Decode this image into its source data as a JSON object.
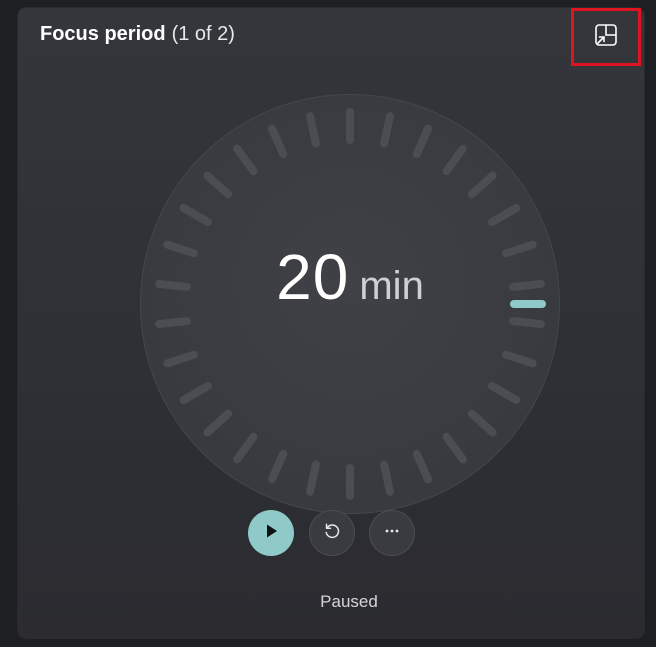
{
  "header": {
    "title": "Focus period",
    "subtitle": "(1 of 2)"
  },
  "timer": {
    "value": "20",
    "unit": "min",
    "status": "Paused",
    "progress_fraction": 0.0
  },
  "toolbar": {
    "compact_icon": "keep-on-top-icon",
    "play_icon": "play-icon",
    "reset_icon": "reset-icon",
    "more_icon": "more-icon"
  },
  "colors": {
    "accent": "#8fcac8",
    "tick": "#4b4d53",
    "highlight_border": "#e0141e"
  }
}
